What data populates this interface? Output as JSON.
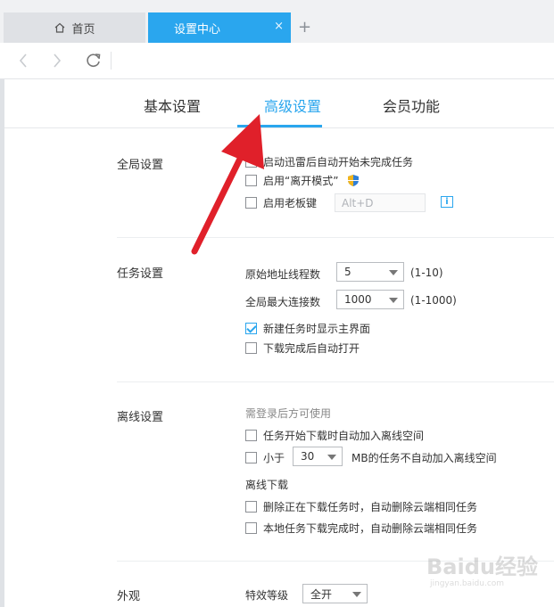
{
  "browser": {
    "tabs": [
      {
        "label": "首页",
        "icon": "home-icon"
      },
      {
        "label": "设置中心",
        "active": true,
        "close": "×"
      }
    ],
    "new_tab": "+",
    "accent": "#2aa6ee"
  },
  "settings_tabs": [
    {
      "label": "基本设置"
    },
    {
      "label": "高级设置",
      "active": true
    },
    {
      "label": "会员功能"
    }
  ],
  "global": {
    "title": "全局设置",
    "auto_resume": "启动迅雷后自动开始未完成任务",
    "leave_mode": "启用“离开模式”",
    "boss_key": "启用老板键",
    "boss_key_value": "Alt+D"
  },
  "task": {
    "title": "任务设置",
    "threads_label": "原始地址线程数",
    "threads_value": "5",
    "threads_range": "(1-10)",
    "max_conn_label": "全局最大连接数",
    "max_conn_value": "1000",
    "max_conn_range": "(1-1000)",
    "show_main": "新建任务时显示主界面",
    "show_main_checked": true,
    "auto_open": "下载完成后自动打开"
  },
  "offline": {
    "title": "离线设置",
    "note": "需登录后方可使用",
    "auto_add": "任务开始下载时自动加入离线空间",
    "less_than": "小于",
    "size_value": "30",
    "size_suffix": "MB的任务不自动加入离线空间",
    "download_title": "离线下载",
    "delete_downloading": "删除正在下载任务时，自动删除云端相同任务",
    "delete_completed": "本地任务下载完成时，自动删除云端相同任务"
  },
  "appearance": {
    "title": "外观",
    "effect_label": "特效等级",
    "effect_value": "全开"
  },
  "watermark": {
    "text": "Baidu经验",
    "url": "jingyan.baidu.com"
  }
}
